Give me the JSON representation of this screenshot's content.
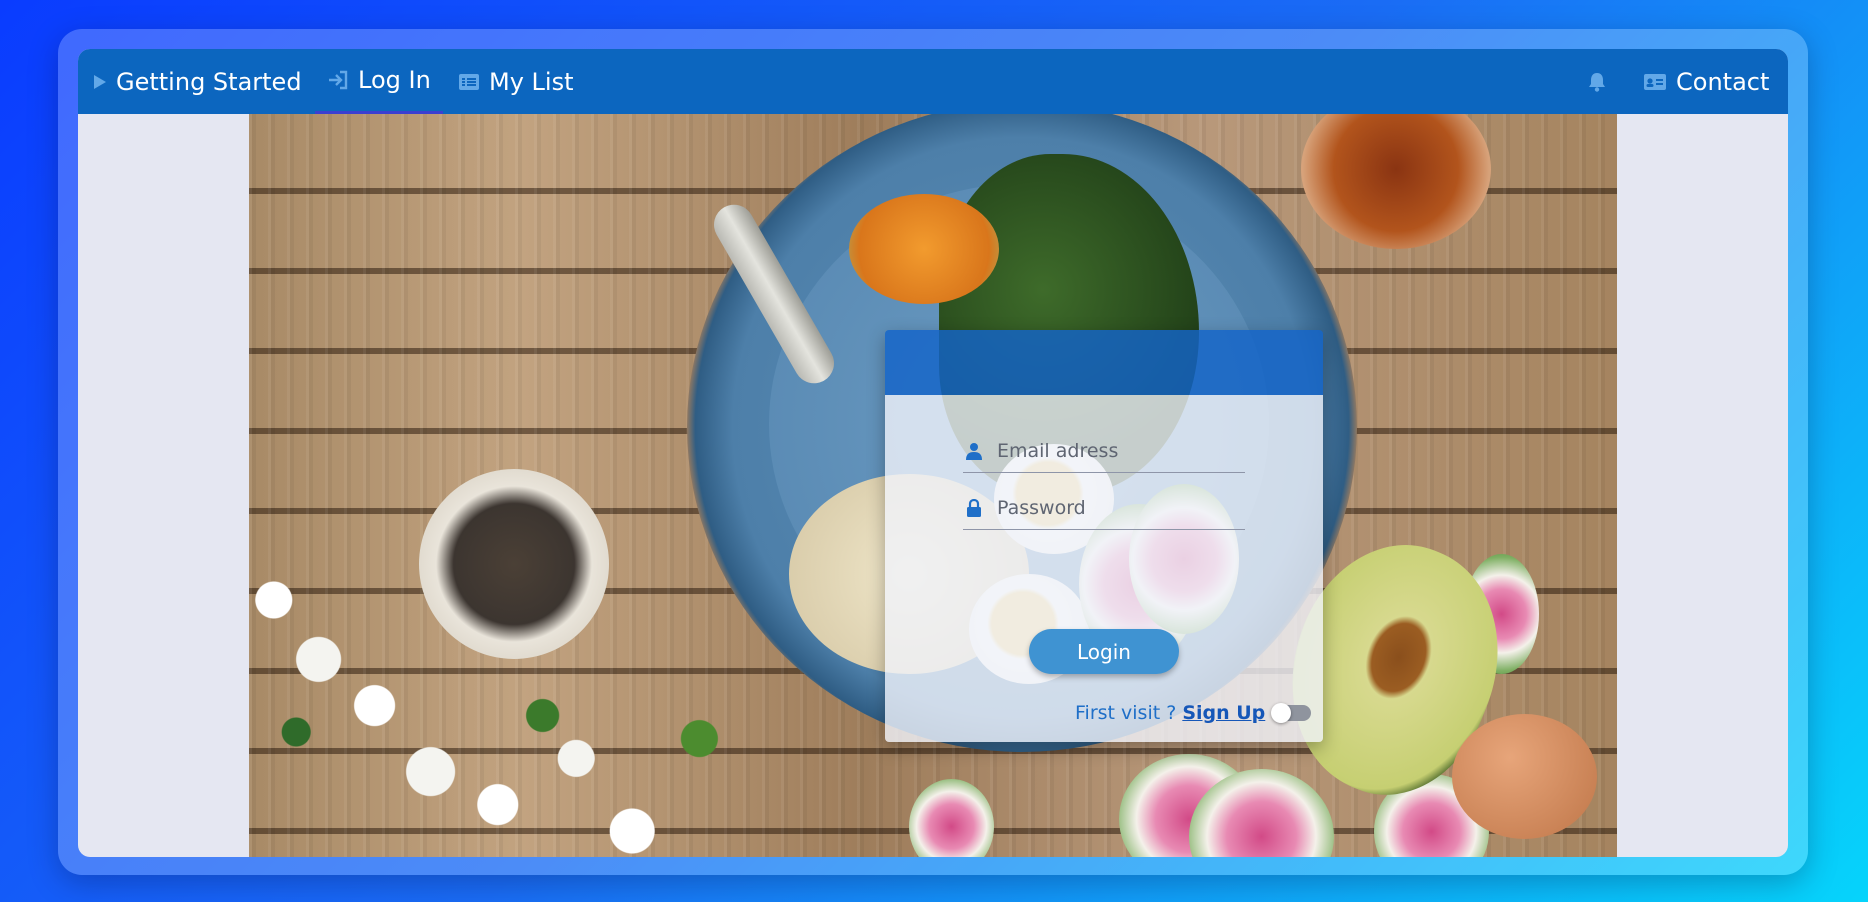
{
  "nav": {
    "getting_started": "Getting Started",
    "log_in": "Log In",
    "my_list": "My List",
    "contact": "Contact",
    "active_tab": "Log In"
  },
  "login_form": {
    "email_placeholder": "Email adress",
    "password_placeholder": "Password",
    "login_button": "Login",
    "first_visit_text": "First visit ?",
    "sign_up_link": "Sign Up",
    "toggle_on": false
  },
  "icons": {
    "getting_started": "play-icon",
    "log_in": "sign-in-icon",
    "my_list": "list-icon",
    "notifications": "bell-icon",
    "contact": "id-card-icon",
    "email": "user-icon",
    "password": "lock-icon"
  },
  "colors": {
    "navbar": "#0c66bf",
    "active_underline": "#3b3fd1",
    "card_header": "#1464c8",
    "login_button": "#3f93d2",
    "link": "#1657b8"
  }
}
